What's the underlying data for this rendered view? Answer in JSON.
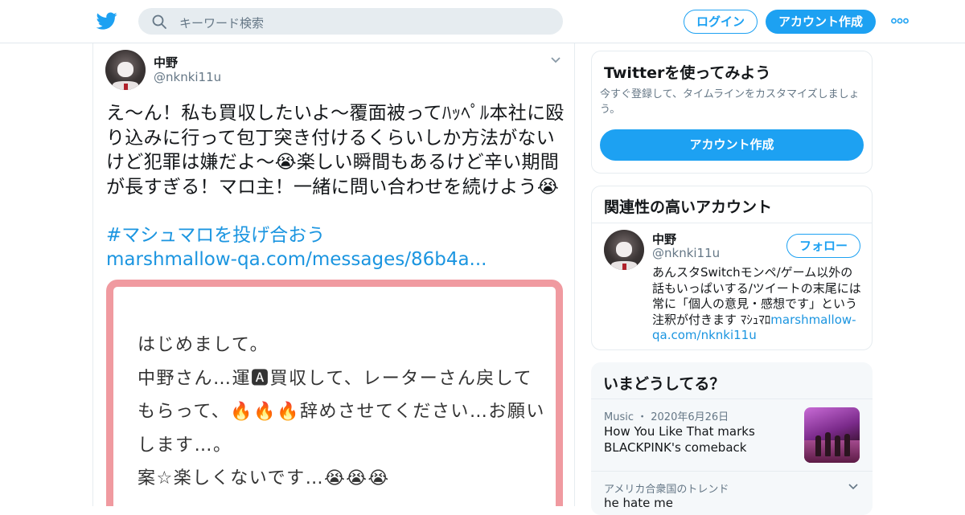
{
  "header": {
    "search_placeholder": "キーワード検索",
    "login_label": "ログイン",
    "signup_label": "アカウント作成"
  },
  "tweet": {
    "author_name": "中野",
    "author_handle": "@nknki11u",
    "text": "え～ん！私も買収したいよ～覆面被ってﾊｯﾍﾟﾙ本社に殴り込みに行って包丁突き付けるくらいしか方法がないけど犯罪は嫌だよ～😭楽しい瞬間もあるけど辛い期間が長すぎる！マロ主！一緒に問い合わせを続けよう😭",
    "hashtag": "#マシュマロを投げ合おう",
    "link": "marshmallow-qa.com/messages/86b4a...",
    "card_lines": [
      "はじめまして。",
      "中野さん…運🅰買収して、レーターさん戻して",
      "もらって、🔥🔥🔥辞めさせてください…お願い",
      "します…。",
      "案☆楽しくないです…😭😭😭"
    ]
  },
  "sidebar": {
    "try_twitter": {
      "title": "Twitterを使ってみよう",
      "subtitle": "今すぐ登録して、タイムラインをカスタマイズしましょう。",
      "button": "アカウント作成"
    },
    "related": {
      "title": "関連性の高いアカウント",
      "name": "中野",
      "handle": "@nknki11u",
      "follow_label": "フォロー",
      "bio_text": "あんスタSwitchモンペ/ゲーム以外の話もいっぱいする/ツイートの末尾には常に「個人の意見・感想です」という注釈が付きます ﾏｼｭﾏﾛ",
      "bio_link": "marshmallow-qa.com/nknki11u"
    },
    "trends": {
      "title": "いまどうしてる？",
      "items": [
        {
          "meta": "Music ・ 2020年6月26日",
          "title": "How You Like That marks BLACKPINK's comeback"
        },
        {
          "meta": "アメリカ合衆国のトレンド",
          "title": "he hate me"
        }
      ]
    }
  },
  "colors": {
    "brand_blue": "#1da1f2",
    "link_blue": "#1b95e0",
    "card_border": "#f09aa0"
  },
  "icons": [
    "twitter-bird-icon",
    "search-icon",
    "more-dots-icon",
    "chevron-down-icon"
  ]
}
